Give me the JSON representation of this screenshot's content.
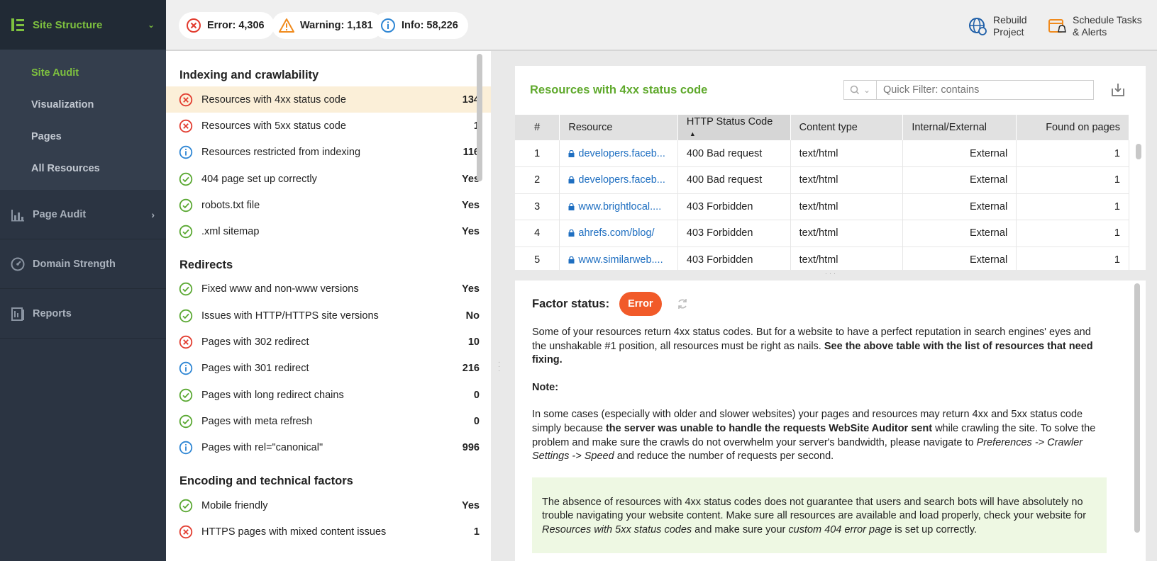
{
  "sidebar": {
    "header": "Site Structure",
    "sub_items": [
      "Site Audit",
      "Visualization",
      "Pages",
      "All Resources"
    ],
    "sections": [
      {
        "label": "Page Audit",
        "icon": "bar-chart-icon"
      },
      {
        "label": "Domain Strength",
        "icon": "speedometer-icon"
      },
      {
        "label": "Reports",
        "icon": "reports-icon"
      }
    ]
  },
  "topbar": {
    "error": "Error: 4,306",
    "warning": "Warning: 1,181",
    "info": "Info: 58,226",
    "rebuild_l1": "Rebuild",
    "rebuild_l2": "Project",
    "schedule_l1": "Schedule Tasks",
    "schedule_l2": "& Alerts"
  },
  "issues": {
    "s1_title": "Indexing and crawlability",
    "s1": [
      {
        "status": "error",
        "label": "Resources with 4xx status code",
        "value": "134"
      },
      {
        "status": "error",
        "label": "Resources with 5xx status code",
        "value": "1"
      },
      {
        "status": "info",
        "label": "Resources restricted from indexing",
        "value": "116"
      },
      {
        "status": "ok",
        "label": "404 page set up correctly",
        "value": "Yes"
      },
      {
        "status": "ok",
        "label": "robots.txt file",
        "value": "Yes"
      },
      {
        "status": "ok",
        "label": ".xml sitemap",
        "value": "Yes"
      }
    ],
    "s2_title": "Redirects",
    "s2": [
      {
        "status": "ok",
        "label": "Fixed www and non-www versions",
        "value": "Yes"
      },
      {
        "status": "ok",
        "label": "Issues with HTTP/HTTPS site versions",
        "value": "No"
      },
      {
        "status": "error",
        "label": "Pages with 302 redirect",
        "value": "10"
      },
      {
        "status": "info",
        "label": "Pages with 301 redirect",
        "value": "216"
      },
      {
        "status": "ok",
        "label": "Pages with long redirect chains",
        "value": "0"
      },
      {
        "status": "ok",
        "label": "Pages with meta refresh",
        "value": "0"
      },
      {
        "status": "info",
        "label": "Pages with rel=\"canonical\"",
        "value": "996"
      }
    ],
    "s3_title": "Encoding and technical factors",
    "s3": [
      {
        "status": "ok",
        "label": "Mobile friendly",
        "value": "Yes"
      },
      {
        "status": "error",
        "label": "HTTPS pages with mixed content issues",
        "value": "1"
      }
    ]
  },
  "resources": {
    "title": "Resources with 4xx status code",
    "filter_placeholder": "Quick Filter: contains",
    "columns": [
      "#",
      "Resource",
      "HTTP Status Code",
      "Content type",
      "Internal/External",
      "Found on pages"
    ],
    "rows": [
      {
        "n": "1",
        "resource": "developers.faceb...",
        "status": "400 Bad request",
        "type": "text/html",
        "ext": "External",
        "found": "1"
      },
      {
        "n": "2",
        "resource": "developers.faceb...",
        "status": "400 Bad request",
        "type": "text/html",
        "ext": "External",
        "found": "1"
      },
      {
        "n": "3",
        "resource": "www.brightlocal....",
        "status": "403 Forbidden",
        "type": "text/html",
        "ext": "External",
        "found": "1"
      },
      {
        "n": "4",
        "resource": "ahrefs.com/blog/",
        "status": "403 Forbidden",
        "type": "text/html",
        "ext": "External",
        "found": "1"
      },
      {
        "n": "5",
        "resource": "www.similarweb....",
        "status": "403 Forbidden",
        "type": "text/html",
        "ext": "External",
        "found": "1"
      }
    ]
  },
  "factor": {
    "label": "Factor status:",
    "badge": "Error",
    "p1_a": "Some of your resources return 4xx status codes. But for a website to have a perfect reputation in search engines' eyes and the unshakable #1 position, all resources must be right as nails. ",
    "p1_b": "See the above table with the list of resources that need fixing.",
    "note": "Note:",
    "p2_a": "In some cases (especially with older and slower websites) your pages and resources may return 4xx and 5xx status code simply because ",
    "p2_b": "the server was unable to handle the requests WebSite Auditor sent",
    "p2_c": " while crawling the site. To solve the problem and make sure the crawls do not overwhelm your server's bandwidth, please navigate to ",
    "p2_d": "Preferences -> Crawler Settings -> Speed",
    "p2_e": " and reduce the number of requests per second.",
    "tip_a": "The absence of resources with 4xx status codes does not guarantee that users and search bots will have absolutely no trouble navigating your website content. Make sure all resources are available and load properly, check your website for ",
    "tip_b": "Resources with 5xx status codes",
    "tip_c": " and make sure your ",
    "tip_d": "custom 404 error page",
    "tip_e": " is set up correctly."
  },
  "colors": {
    "accent": "#7ec13f",
    "error": "#e23b2e",
    "info": "#2e86d4",
    "ok": "#5aa832",
    "warning": "#f08a1c"
  }
}
